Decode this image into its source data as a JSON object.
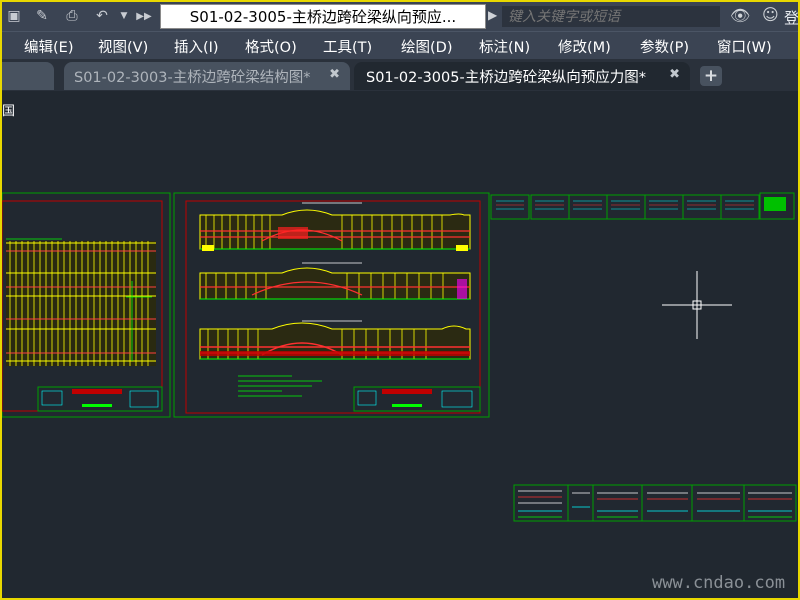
{
  "title": "S01-02-3005-主桥边跨砼梁纵向预应...",
  "search": {
    "placeholder": "键入关键字或短语"
  },
  "login_label": "登",
  "menus": [
    "编辑(E)",
    "视图(V)",
    "插入(I)",
    "格式(O)",
    "工具(T)",
    "绘图(D)",
    "标注(N)",
    "修改(M)",
    "参数(P)",
    "窗口(W)"
  ],
  "tabs": [
    "S01-02-3003-主桥边跨砼梁结构图*",
    "S01-02-3005-主桥边跨砼梁纵向预应力图*"
  ],
  "tab_add": "+",
  "side_label": "国",
  "watermark": "www.cndao.com",
  "colors": {
    "accent": "#e8d800",
    "drawing_bg": "#212830",
    "cad_yellow": "#ffff00",
    "cad_red": "#c00000",
    "cad_green": "#00c000"
  },
  "icons": [
    "save-icon",
    "edit-icon",
    "print-icon",
    "undo-icon",
    "dropdown-icon",
    "more-icon",
    "binoculars-icon",
    "user-icon",
    "crosshair-icon"
  ]
}
